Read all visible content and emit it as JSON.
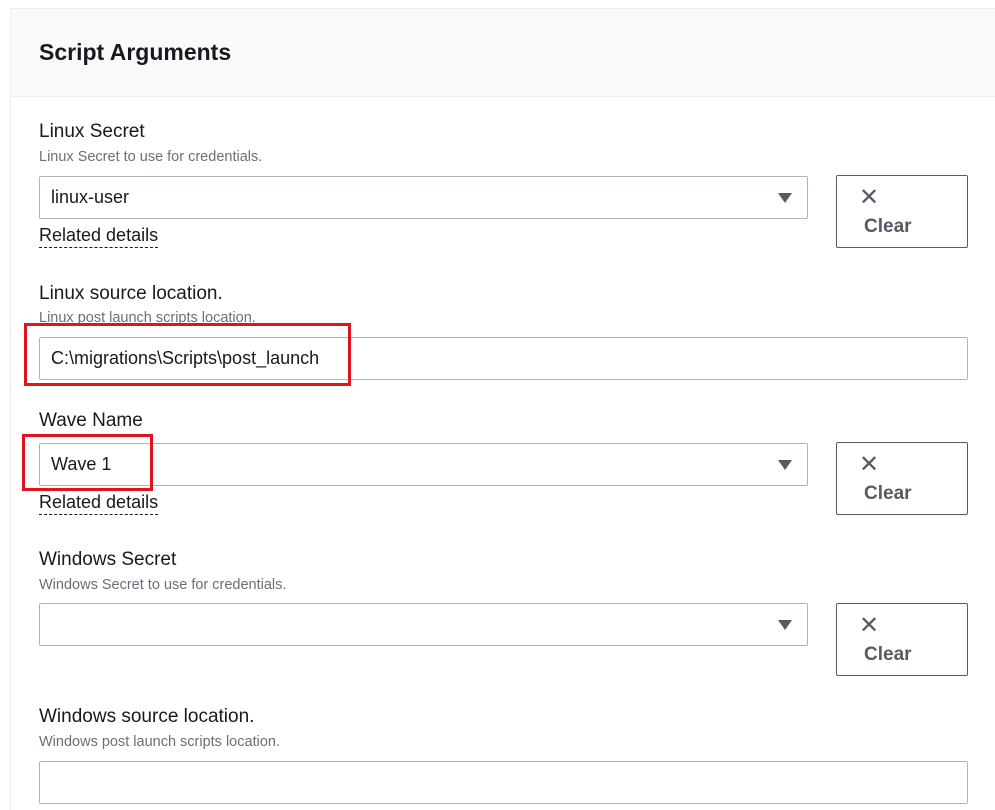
{
  "panel": {
    "title": "Script Arguments"
  },
  "linux_secret": {
    "label": "Linux Secret",
    "description": "Linux Secret to use for credentials.",
    "value": "linux-user",
    "related": "Related details",
    "clear_label": "Clear"
  },
  "linux_source": {
    "label": "Linux source location.",
    "description": "Linux post launch scripts location.",
    "value": "C:\\migrations\\Scripts\\post_launch"
  },
  "wave_name": {
    "label": "Wave Name",
    "value": "Wave 1",
    "related": "Related details",
    "clear_label": "Clear"
  },
  "windows_secret": {
    "label": "Windows Secret",
    "description": "Windows Secret to use for credentials.",
    "value": "",
    "clear_label": "Clear"
  },
  "windows_source": {
    "label": "Windows source location.",
    "description": "Windows post launch scripts location.",
    "value": ""
  },
  "icons": {
    "clear": "close-icon",
    "dropdown": "caret-down-icon"
  },
  "colors": {
    "highlight": "#e0141e",
    "border": "#aab7b8",
    "button_text": "#545b64"
  }
}
